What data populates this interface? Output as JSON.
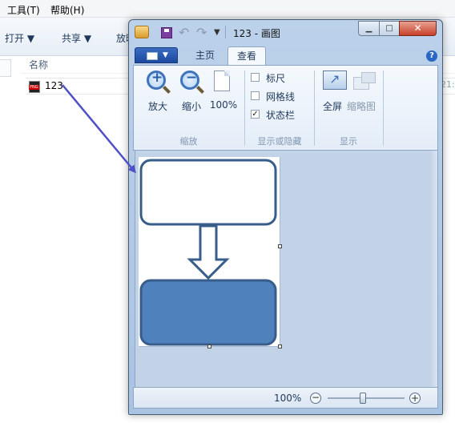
{
  "explorer": {
    "menu": {
      "tools": "工具(T)",
      "help": "帮助(H)"
    },
    "toolbar": {
      "open": "打开 ▼",
      "share": "共享 ▼",
      "more": "放映"
    },
    "column_header": "名称",
    "file": {
      "name": "123",
      "icon": "png-file-icon",
      "right_text": "21:"
    }
  },
  "paint": {
    "title": "123 - 画图",
    "window_buttons": {
      "min": "▁",
      "max": "□",
      "close": "✕"
    },
    "tabs": {
      "home": "主页",
      "view": "查看"
    },
    "help": "?",
    "ribbon": {
      "zoom_group": {
        "label": "缩放",
        "zoom_in": "放大",
        "zoom_out": "缩小",
        "actual": "100%"
      },
      "show_group": {
        "label": "显示或隐藏",
        "ruler": "标尺",
        "ruler_checked": false,
        "gridlines": "网格线",
        "gridlines_checked": false,
        "statusbar": "状态栏",
        "statusbar_checked": true,
        "check_mark": "✓"
      },
      "display_group": {
        "label": "显示",
        "fullscreen": "全屏",
        "thumbnail": "缩略图"
      }
    },
    "status": {
      "zoom": "100%",
      "minus": "−",
      "plus": "+"
    },
    "drawing": {
      "box_fill_top": "#ffffff",
      "box_fill_bottom": "#4f81bd",
      "stroke": "#385d8a"
    }
  },
  "colors": {
    "accent": "#1e395b",
    "annotation_arrow": "#4f4fc8"
  }
}
